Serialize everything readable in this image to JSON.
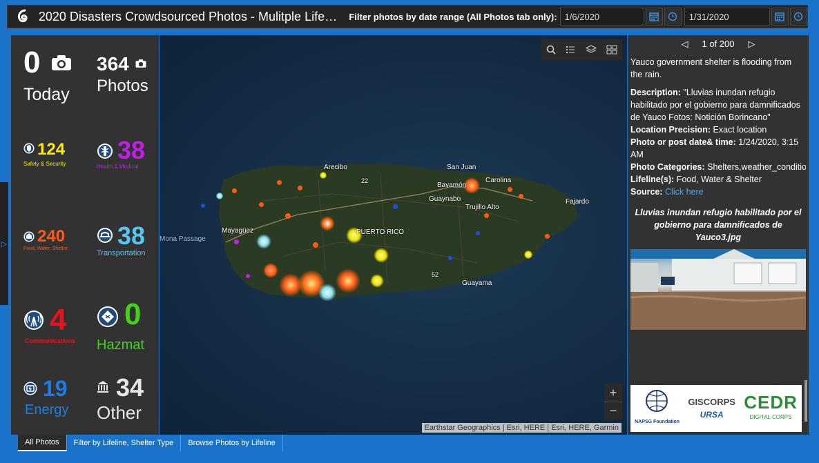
{
  "header": {
    "title": "2020 Disasters Crowdsourced Photos - Mulitple Life…",
    "filter_label": "Filter photos by date range (All Photos tab only):",
    "start_date": "1/6/2020",
    "end_date": "1/31/2020"
  },
  "stats": {
    "today": {
      "value": "0",
      "label": "Today"
    },
    "photos": {
      "value": "364",
      "label": "Photos"
    },
    "safety": {
      "value": "124",
      "label": "Safety & Security",
      "color": "#ffeb00"
    },
    "health": {
      "value": "38",
      "label": "Health & Medical",
      "color": "#c21ee8"
    },
    "food": {
      "value": "240",
      "label": "Food, Water, Shelter",
      "color": "#ff5a14"
    },
    "transportation": {
      "value": "38",
      "label": "Transportation",
      "color": "#55c6f2"
    },
    "communications": {
      "value": "4",
      "label": "Communications",
      "color": "#e8131a"
    },
    "hazmat": {
      "value": "0",
      "label": "Hazmat",
      "color": "#44d11a"
    },
    "energy": {
      "value": "19",
      "label": "Energy",
      "color": "#1b7ee8"
    },
    "other": {
      "value": "34",
      "label": "Other",
      "color": "#e6e6e6"
    }
  },
  "map": {
    "labels": {
      "arecibo": "Arecibo",
      "san_juan": "San Juan",
      "bayamon": "Bayamón",
      "carolina": "Carolina",
      "guaynabo": "Guaynabo",
      "trujillo_alto": "Trujillo Alto",
      "fajardo": "Fajardo",
      "mayaguez": "Mayagüez",
      "mona_passage": "Mona Passage",
      "puerto_rico": "PUERTO RICO",
      "guayama": "Guayama",
      "route_22": "22",
      "route_52": "52"
    },
    "attribution": "Earthstar Geographics | Esri, HERE | Esri, HERE, Garmin",
    "zoom_in": "+",
    "zoom_out": "−"
  },
  "info": {
    "pager": "1 of 200",
    "headline": "Yauco government shelter is flooding from the rain.",
    "description_label": "Description:",
    "description": "\"Lluvias inundan refugio habilitado por el gobierno para damnificados de Yauco Fotos: Notición Borincano\"",
    "precision_label": "Location Precision:",
    "precision": "Exact location",
    "date_label": "Photo or post date& time:",
    "date": "1/24/2020, 3:15 AM",
    "categories_label": "Photo Categories:",
    "categories": "Shelters,weather_conditions,Other",
    "lifeline_label": "Lifeline(s):",
    "lifeline": "Food, Water & Shelter",
    "source_label": "Source:",
    "source_link": "Click here",
    "caption": "Lluvias inundan refugio habilitado por el gobierno para damnificados de Yauco3.jpg",
    "logo_napsg": "NAPSG Foundation",
    "logo_giscorps": "GISCORPS",
    "logo_cedr": "CEDR",
    "logo_cedr_sub": "DIGITAL CORPS"
  },
  "tabs": [
    "All Photos",
    "Filter by Lifeline, Shelter Type",
    "Browse Photos by Lifeline"
  ]
}
